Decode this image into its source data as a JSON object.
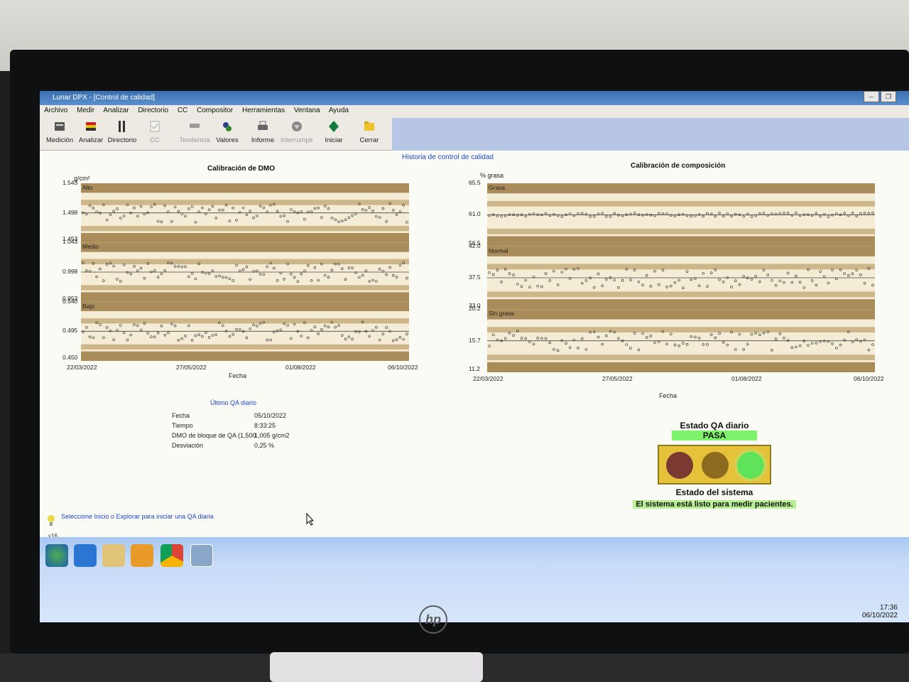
{
  "window": {
    "title": "Lunar DPX - [Control de calidad]",
    "min_label": "–",
    "restore_label": "❐"
  },
  "menu": [
    "Archivo",
    "Medir",
    "Analizar",
    "Directorio",
    "CC",
    "Compositor",
    "Herramientas",
    "Ventana",
    "Ayuda"
  ],
  "toolbar": [
    {
      "label": "Medición",
      "icon": "scanner-icon",
      "enabled": true
    },
    {
      "label": "Analizar",
      "icon": "analyze-icon",
      "enabled": true
    },
    {
      "label": "Directorio",
      "icon": "directory-icon",
      "enabled": true
    },
    {
      "label": "CC",
      "icon": "qc-icon",
      "enabled": false
    },
    {
      "label": "Tendencia",
      "icon": "trend-icon",
      "enabled": false
    },
    {
      "label": "Valores",
      "icon": "values-icon",
      "enabled": true
    },
    {
      "label": "Informe",
      "icon": "printer-icon",
      "enabled": true
    },
    {
      "label": "Interrumpir",
      "icon": "stop-icon",
      "enabled": false
    },
    {
      "label": "Iniciar",
      "icon": "start-icon",
      "enabled": true
    },
    {
      "label": "Cerrar",
      "icon": "close-folder-icon",
      "enabled": true
    }
  ],
  "qa_history_title": "Historia de control de calidad",
  "charts": [
    {
      "title": "Calibración de DMO",
      "unit": "g/cm²",
      "xlabel": "Fecha",
      "x_ticks": [
        "22/03/2022",
        "27/05/2022",
        "01/08/2022",
        "06/10/2022"
      ],
      "bands": [
        {
          "label": "Alto",
          "top": "1.543",
          "mid": "1.498",
          "bottom": "1.453",
          "mean": 1.498,
          "band_color": "#a98c5a"
        },
        {
          "label": "Medio",
          "top": "1.043",
          "mid": "0.998",
          "bottom": "0.953",
          "mean": 0.998,
          "band_color": "#a98c5a"
        },
        {
          "label": "Bajo",
          "top": "0.540",
          "mid": "0.495",
          "bottom": "0.450",
          "mean": 0.495,
          "band_color": "#a98c5a"
        }
      ]
    },
    {
      "title": "Calibración de composición",
      "unit": "% grasa",
      "xlabel": "Fecha",
      "x_ticks": [
        "22/03/2022",
        "27/05/2022",
        "01/08/2022",
        "06/10/2022"
      ],
      "bands": [
        {
          "label": "Grasa",
          "top": "65.5",
          "mid": "61.0",
          "bottom": "56.5",
          "mean": 61.0,
          "band_color": "#a98c5a"
        },
        {
          "label": "Normal",
          "top": "42.0",
          "mid": "37.5",
          "bottom": "33.0",
          "mean": 37.5,
          "band_color": "#a98c5a"
        },
        {
          "label": "Sin grasa",
          "top": "20.2",
          "mid": "15.7",
          "bottom": "11.2",
          "mean": 15.7,
          "band_color": "#a98c5a"
        }
      ]
    }
  ],
  "last_qa": {
    "heading": "Último QA diario",
    "rows": [
      {
        "label": "Fecha",
        "value": "05/10/2022"
      },
      {
        "label": "Tiempo",
        "value": "8:33:25"
      },
      {
        "label": "DMO de bloque de QA (1,500",
        "value": "1,005 g/cm2"
      },
      {
        "label": "Desviación",
        "value": "0,25  %"
      }
    ]
  },
  "status": {
    "qa_label": "Estado QA diario",
    "qa_value": "PASA",
    "system_label": "Estado del sistema",
    "system_message": "El sistema está listo para medir pacientes.",
    "lamp_colors": [
      "#7a3a32",
      "#8c6a1e",
      "#5ee35a"
    ],
    "active_lamp": "green"
  },
  "hint": "Seleccione Inicio o Explorar para iniciar una QA diaria",
  "version": "v16",
  "taskbar": {
    "apps": [
      "start-orb-icon",
      "ie-icon",
      "explorer-icon",
      "media-player-icon",
      "chrome-icon",
      "lunar-app-icon"
    ],
    "time": "17:36",
    "date": "06/10/2022"
  },
  "brand": "hp"
}
